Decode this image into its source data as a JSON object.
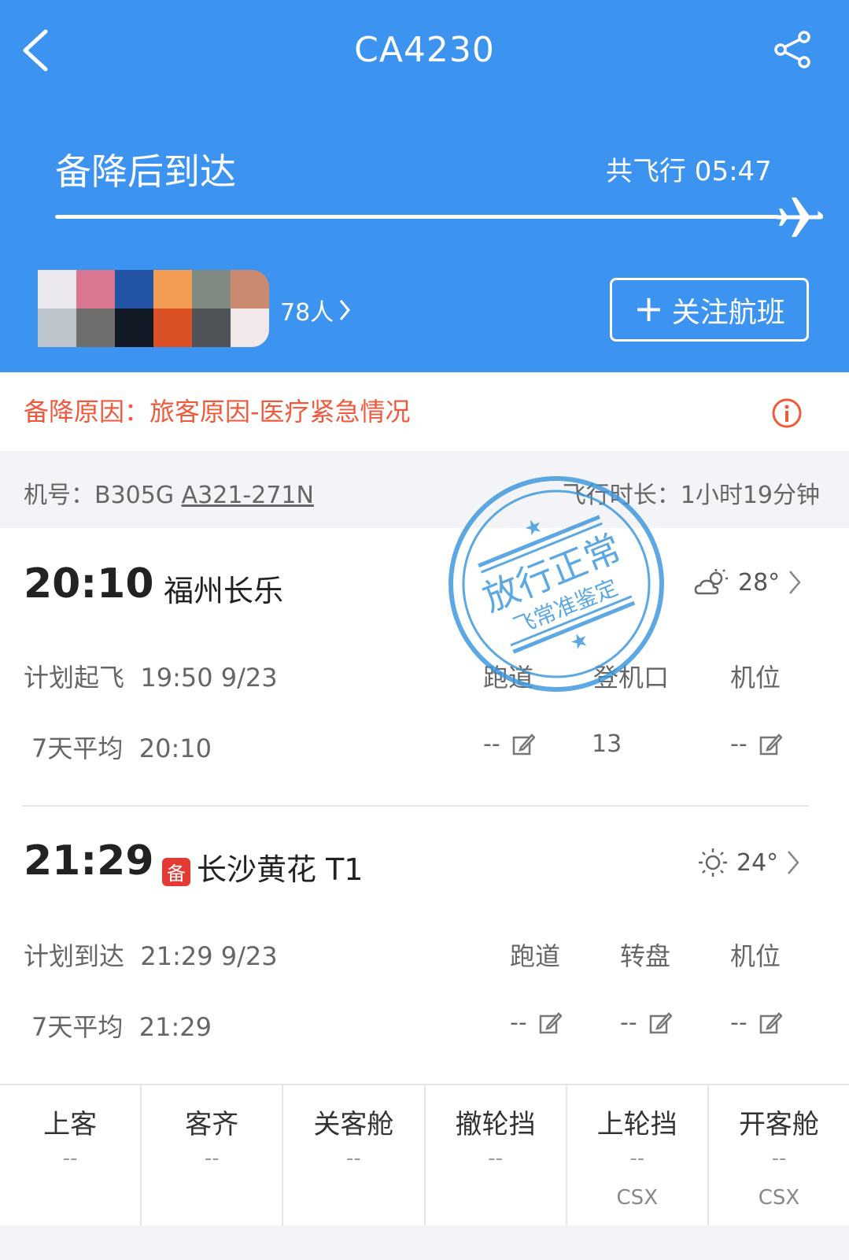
{
  "header": {
    "title": "CA4230",
    "status": "备降后到达",
    "duration": "共飞行 05:47",
    "passengers": "78人",
    "follow_label": "关注航班",
    "avatar_colors": [
      "#ece9ee",
      "#d97690",
      "#2353a3",
      "#f29b52",
      "#7e8a82",
      "#c98a70",
      "#bcc4cc",
      "#6f706e",
      "#111a24",
      "#db5125",
      "#4f5257",
      "#f1e8ea"
    ]
  },
  "reason": {
    "text": "备降原因：旅客原因-医疗紧急情况"
  },
  "aircraft": {
    "label": "机号：B305G ",
    "model": "A321-271N",
    "flight_time": "飞行时长：1小时19分钟"
  },
  "departure": {
    "time": "20:10",
    "city": "福州长乐",
    "temp": "28°",
    "planned_label": "计划起飞",
    "planned": "19:50 9/23",
    "avg_label": "7天平均",
    "avg": "20:10",
    "cols": [
      "跑道",
      "登机口",
      "机位"
    ],
    "values": [
      "--",
      "13",
      "--"
    ]
  },
  "arrival": {
    "time": "21:29",
    "badge": "备",
    "city": "长沙黄花 T1",
    "temp": "24°",
    "planned_label": "计划到达",
    "planned": "21:29 9/23",
    "avg_label": "7天平均",
    "avg": "21:29",
    "cols": [
      "跑道",
      "转盘",
      "机位"
    ],
    "values": [
      "--",
      "--",
      "--"
    ]
  },
  "bottom": [
    {
      "label": "上客",
      "value": "--",
      "apt": ""
    },
    {
      "label": "客齐",
      "value": "--",
      "apt": ""
    },
    {
      "label": "关客舱",
      "value": "--",
      "apt": ""
    },
    {
      "label": "撤轮挡",
      "value": "--",
      "apt": ""
    },
    {
      "label": "上轮挡",
      "value": "--",
      "apt": "CSX"
    },
    {
      "label": "开客舱",
      "value": "--",
      "apt": "CSX"
    }
  ],
  "stamp": {
    "line1": "放行正常",
    "line2": "飞常准鉴定"
  },
  "colors": {
    "header": "#3d93f0",
    "alert": "#f05a3c",
    "stamp": "#3a96dc"
  }
}
